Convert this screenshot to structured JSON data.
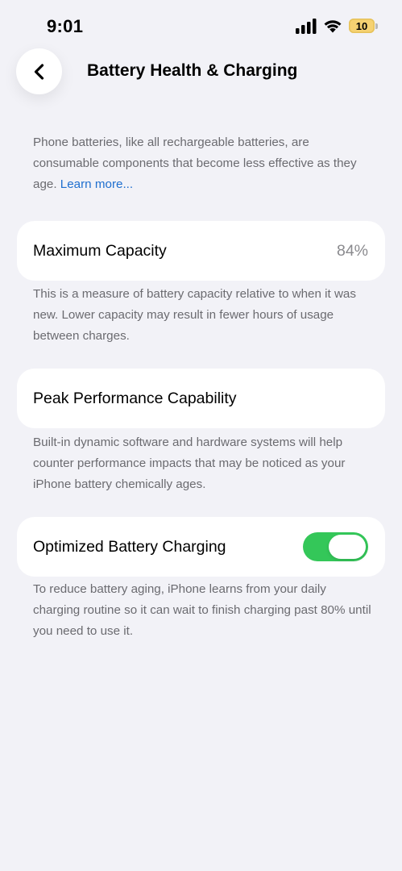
{
  "status_bar": {
    "time": "9:01",
    "battery_level": "10",
    "signal_icon": "cellular-signal-icon",
    "wifi_icon": "wifi-icon",
    "battery_color": "#f6d272"
  },
  "nav": {
    "back_icon": "chevron-left-icon",
    "title": "Battery Health & Charging"
  },
  "intro": {
    "text": "Phone batteries, like all rechargeable batteries, are consumable components that become less effective as they age. ",
    "link": "Learn more..."
  },
  "max_capacity": {
    "label": "Maximum Capacity",
    "value": "84%",
    "footnote": "This is a measure of battery capacity relative to when it was new. Lower capacity may result in fewer hours of usage between charges."
  },
  "peak_performance": {
    "label": "Peak Performance Capability",
    "footnote": "Built-in dynamic software and hardware systems will help counter performance impacts that may be noticed as your iPhone battery chemically ages."
  },
  "optimized_charging": {
    "label": "Optimized Battery Charging",
    "enabled": true,
    "toggle_color": "#34c759",
    "footnote": "To reduce battery aging, iPhone learns from your daily charging routine so it can wait to finish charging past 80% until you need to use it."
  },
  "colors": {
    "background": "#f2f2f7",
    "link": "#1f6fcf",
    "secondary_text": "#6b6b70"
  }
}
